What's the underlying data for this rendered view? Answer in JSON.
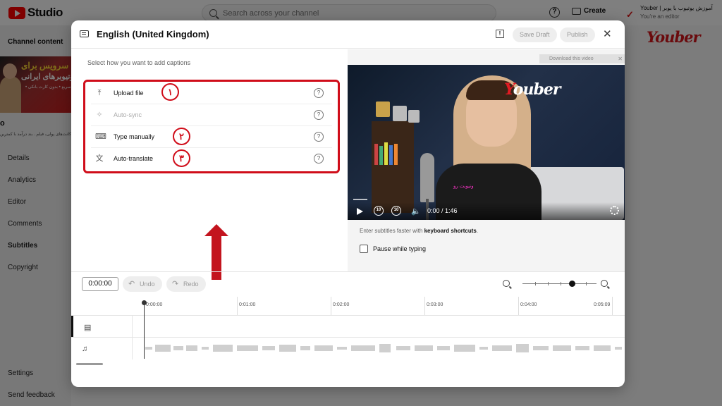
{
  "app": {
    "logo_text": "Studio",
    "search_placeholder": "Search across your channel",
    "create_label": "Create",
    "account_name": "Youber | آموزش یوتیوب با یوبر",
    "account_role": "You're an editor",
    "brand": "Youber"
  },
  "sidebar": {
    "heading": "Channel content",
    "thumb_line1": "سرویس برای",
    "thumb_line2": "یوتیوبرهای ایرانی",
    "thumb_small": "• بدون خطر • ساده و سریع • بدون کارت بانکی",
    "video_letter": "o",
    "video_desc": "اکانت‌های پولی، فیلم . بند درآمد با کمترین",
    "items": [
      {
        "label": "Details"
      },
      {
        "label": "Analytics"
      },
      {
        "label": "Editor"
      },
      {
        "label": "Comments"
      },
      {
        "label": "Subtitles"
      },
      {
        "label": "Copyright"
      }
    ],
    "bottom": [
      {
        "label": "Settings"
      },
      {
        "label": "Send feedback"
      }
    ]
  },
  "dialog": {
    "title": "English (United Kingdom)",
    "save_draft": "Save Draft",
    "publish": "Publish",
    "select_label": "Select how you want to add captions",
    "options": [
      {
        "label": "Upload file",
        "icon": "upload-icon",
        "enabled": true,
        "badge": "۱"
      },
      {
        "label": "Auto-sync",
        "icon": "auto-sync-icon",
        "enabled": false,
        "badge": ""
      },
      {
        "label": "Type manually",
        "icon": "keyboard-icon",
        "enabled": true,
        "badge": "۲"
      },
      {
        "label": "Auto-translate",
        "icon": "translate-icon",
        "enabled": true,
        "badge": "۳"
      }
    ],
    "download_bar": "Download this video",
    "video_time": "0:00 / 1:46",
    "shortcut_prefix": "Enter subtitles faster with ",
    "shortcut_link": "keyboard shortcuts",
    "shortcut_suffix": ".",
    "pause_label": "Pause while typing",
    "timecode": "0:00:00",
    "undo": "Undo",
    "redo": "Redo",
    "ruler": [
      "0:00:00",
      "0:01:00",
      "0:02:00",
      "0:03:00",
      "0:04:00",
      "0:05:09"
    ],
    "video_brand_y": "Y",
    "video_brand_rest": "ouber",
    "shirt_text": "وتیوبت رو"
  },
  "colors": {
    "accent_red": "#d00d1a",
    "arrow_red": "#c3141e",
    "brand_red": "#d4141a"
  }
}
